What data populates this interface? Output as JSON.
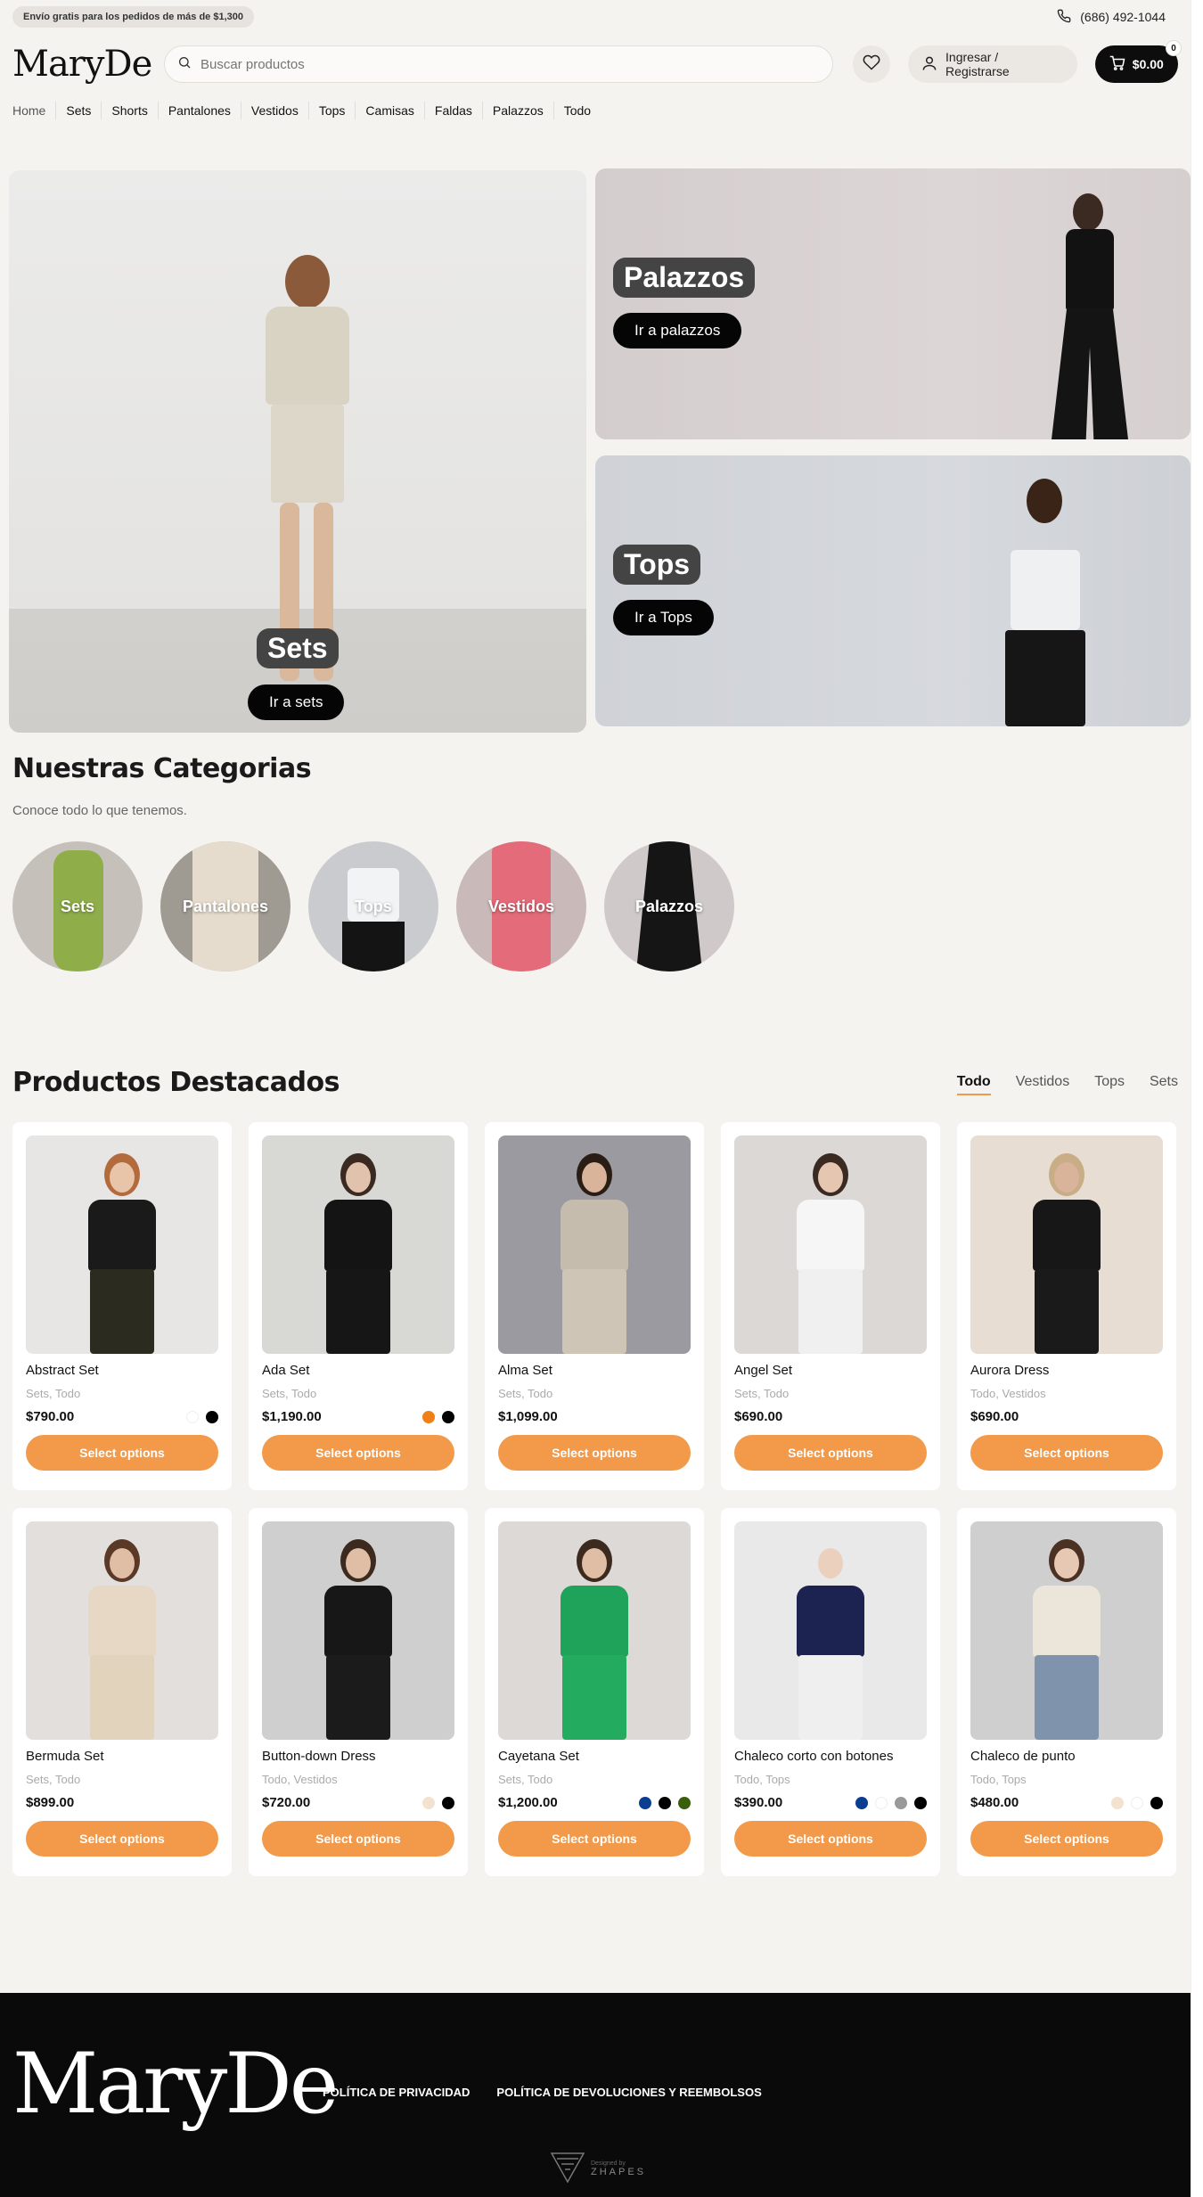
{
  "topbar": {
    "promo": "Envío gratis para los pedidos de más de $1,300",
    "phone": "(686) 492-1044"
  },
  "header": {
    "logo": "MaryDe",
    "search_placeholder": "Buscar productos",
    "login_label": "Ingresar / Registrarse",
    "cart_total": "$0.00",
    "cart_count": "0"
  },
  "nav": [
    "Home",
    "Sets",
    "Shorts",
    "Pantalones",
    "Vestidos",
    "Tops",
    "Camisas",
    "Faldas",
    "Palazzos",
    "Todo"
  ],
  "hero": {
    "sets_title": "Sets",
    "sets_button": "Ir a sets",
    "palazzos_title": "Palazzos",
    "palazzos_button": "Ir a palazzos",
    "tops_title": "Tops",
    "tops_button": "Ir a Tops"
  },
  "categories": {
    "title": "Nuestras Categorias",
    "subtitle": "Conoce todo lo que tenemos.",
    "items": [
      "Sets",
      "Pantalones",
      "Tops",
      "Vestidos",
      "Palazzos"
    ]
  },
  "featured": {
    "title": "Productos Destacados",
    "tabs": [
      "Todo",
      "Vestidos",
      "Tops",
      "Sets"
    ],
    "button_label": "Select options",
    "products": [
      {
        "name": "Abstract Set",
        "cats": [
          "Sets",
          "Todo"
        ],
        "price": "$790.00",
        "swatches": [
          "#ffffff",
          "#000000"
        ]
      },
      {
        "name": "Ada Set",
        "cats": [
          "Sets",
          "Todo"
        ],
        "price": "$1,190.00",
        "swatches": [
          "#f07f1a",
          "#000000"
        ]
      },
      {
        "name": "Alma Set",
        "cats": [
          "Sets",
          "Todo"
        ],
        "price": "$1,099.00",
        "swatches": []
      },
      {
        "name": "Angel Set",
        "cats": [
          "Sets",
          "Todo"
        ],
        "price": "$690.00",
        "swatches": []
      },
      {
        "name": "Aurora Dress",
        "cats": [
          "Todo",
          "Vestidos"
        ],
        "price": "$690.00",
        "swatches": []
      },
      {
        "name": "Bermuda Set",
        "cats": [
          "Sets",
          "Todo"
        ],
        "price": "$899.00",
        "swatches": []
      },
      {
        "name": "Button-down Dress",
        "cats": [
          "Todo",
          "Vestidos"
        ],
        "price": "$720.00",
        "swatches": [
          "#f3e2cf",
          "#000000"
        ]
      },
      {
        "name": "Cayetana Set",
        "cats": [
          "Sets",
          "Todo"
        ],
        "price": "$1,200.00",
        "swatches": [
          "#0b3d91",
          "#000000",
          "#3a5f0b"
        ]
      },
      {
        "name": "Chaleco corto con botones",
        "cats": [
          "Todo",
          "Tops"
        ],
        "price": "$390.00",
        "swatches": [
          "#0b3d91",
          "#ffffff",
          "#999999",
          "#000000"
        ]
      },
      {
        "name": "Chaleco de punto",
        "cats": [
          "Todo",
          "Tops"
        ],
        "price": "$480.00",
        "swatches": [
          "#f3e2cf",
          "#ffffff",
          "#000000"
        ]
      }
    ]
  },
  "footer": {
    "logo": "MaryDe",
    "links": [
      "POLÍTICA DE PRIVACIDAD",
      "POLÍTICA DE DEVOLUCIONES Y REEMBOLSOS"
    ],
    "designed_by": "Designed by",
    "designer": "ZHAPES"
  },
  "colors": {
    "accent": "#f2994a",
    "dark": "#0d0d0d",
    "background": "#f5f3ef"
  }
}
